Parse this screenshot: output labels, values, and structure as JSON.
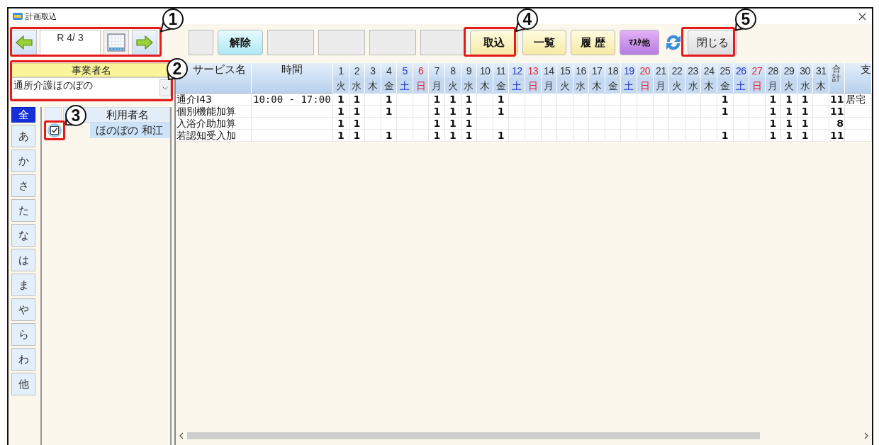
{
  "window": {
    "title": "計画取込"
  },
  "navigator": {
    "date": "R 4/ 3"
  },
  "toolbar": [
    {
      "kind": "blank"
    },
    {
      "kind": "cyan",
      "label": "解除"
    },
    {
      "kind": "blank"
    },
    {
      "kind": "blank"
    },
    {
      "kind": "blank"
    },
    {
      "kind": "blank"
    },
    {
      "kind": "yellow",
      "label": "取込"
    },
    {
      "kind": "yellow",
      "label": "一覧"
    },
    {
      "kind": "yellow",
      "label": "履 歴"
    },
    {
      "kind": "purple",
      "label": "ﾏｽﾀ他"
    },
    {
      "kind": "refresh"
    },
    {
      "kind": "gray",
      "label": "閉じる"
    }
  ],
  "provider": {
    "header": "事業者名",
    "value": "通所介護ほのぼの"
  },
  "kana_filters": [
    {
      "label": "全",
      "selected": true
    },
    {
      "label": "あ",
      "selected": false
    },
    {
      "label": "か",
      "selected": false
    },
    {
      "label": "さ",
      "selected": false
    },
    {
      "label": "た",
      "selected": false
    },
    {
      "label": "な",
      "selected": false
    },
    {
      "label": "は",
      "selected": false
    },
    {
      "label": "ま",
      "selected": false
    },
    {
      "label": "や",
      "selected": false
    },
    {
      "label": "ら",
      "selected": false
    },
    {
      "label": "わ",
      "selected": false
    },
    {
      "label": "他",
      "selected": false
    }
  ],
  "user_list": {
    "header": "利用者名",
    "rows": [
      {
        "name": "ほのぼの 和江",
        "checked": true,
        "selected": true
      }
    ]
  },
  "grid": {
    "columns": {
      "service": "サービス名",
      "time": "時間",
      "total": "合計",
      "support": "支"
    },
    "days": [
      {
        "day": "1",
        "weekday": "火",
        "kind": "weekday"
      },
      {
        "day": "2",
        "weekday": "水",
        "kind": "weekday"
      },
      {
        "day": "3",
        "weekday": "木",
        "kind": "weekday"
      },
      {
        "day": "4",
        "weekday": "金",
        "kind": "weekday"
      },
      {
        "day": "5",
        "weekday": "土",
        "kind": "saturday"
      },
      {
        "day": "6",
        "weekday": "日",
        "kind": "sunday"
      },
      {
        "day": "7",
        "weekday": "月",
        "kind": "weekday"
      },
      {
        "day": "8",
        "weekday": "火",
        "kind": "weekday"
      },
      {
        "day": "9",
        "weekday": "水",
        "kind": "weekday"
      },
      {
        "day": "10",
        "weekday": "木",
        "kind": "weekday"
      },
      {
        "day": "11",
        "weekday": "金",
        "kind": "weekday"
      },
      {
        "day": "12",
        "weekday": "土",
        "kind": "saturday"
      },
      {
        "day": "13",
        "weekday": "日",
        "kind": "sunday"
      },
      {
        "day": "14",
        "weekday": "月",
        "kind": "weekday"
      },
      {
        "day": "15",
        "weekday": "火",
        "kind": "weekday"
      },
      {
        "day": "16",
        "weekday": "水",
        "kind": "weekday"
      },
      {
        "day": "17",
        "weekday": "木",
        "kind": "weekday"
      },
      {
        "day": "18",
        "weekday": "金",
        "kind": "weekday"
      },
      {
        "day": "19",
        "weekday": "土",
        "kind": "saturday"
      },
      {
        "day": "20",
        "weekday": "日",
        "kind": "sunday"
      },
      {
        "day": "21",
        "weekday": "月",
        "kind": "weekday"
      },
      {
        "day": "22",
        "weekday": "火",
        "kind": "weekday"
      },
      {
        "day": "23",
        "weekday": "水",
        "kind": "weekday"
      },
      {
        "day": "24",
        "weekday": "木",
        "kind": "weekday"
      },
      {
        "day": "25",
        "weekday": "金",
        "kind": "weekday"
      },
      {
        "day": "26",
        "weekday": "土",
        "kind": "saturday"
      },
      {
        "day": "27",
        "weekday": "日",
        "kind": "sunday"
      },
      {
        "day": "28",
        "weekday": "月",
        "kind": "weekday"
      },
      {
        "day": "29",
        "weekday": "火",
        "kind": "weekday"
      },
      {
        "day": "30",
        "weekday": "水",
        "kind": "weekday"
      },
      {
        "day": "31",
        "weekday": "木",
        "kind": "weekday"
      }
    ],
    "rows": [
      {
        "service": "通介Ⅰ43",
        "time": "10:00 - 17:00",
        "cells": [
          "1",
          "1",
          null,
          "1",
          null,
          null,
          "1",
          "1",
          "1",
          null,
          "1",
          null,
          null,
          null,
          null,
          null,
          null,
          null,
          null,
          null,
          null,
          null,
          null,
          null,
          "1",
          null,
          null,
          "1",
          "1",
          "1",
          null
        ],
        "total": "11",
        "support": "居宅"
      },
      {
        "service": "個別機能加算",
        "cells": [
          "1",
          "1",
          null,
          "1",
          null,
          null,
          "1",
          "1",
          "1",
          null,
          "1",
          null,
          null,
          null,
          null,
          null,
          null,
          null,
          null,
          null,
          null,
          null,
          null,
          null,
          "1",
          null,
          null,
          "1",
          "1",
          "1",
          null
        ],
        "total": "11"
      },
      {
        "service": "入浴介助加算",
        "cells": [
          "1",
          "1",
          null,
          null,
          null,
          null,
          "1",
          "1",
          "1",
          null,
          null,
          null,
          null,
          null,
          null,
          null,
          null,
          null,
          null,
          null,
          null,
          null,
          null,
          null,
          null,
          null,
          null,
          "1",
          "1",
          "1",
          null
        ],
        "total": "8"
      },
      {
        "service": "若認知受入加",
        "cells": [
          "1",
          "1",
          null,
          "1",
          null,
          null,
          "1",
          "1",
          "1",
          null,
          "1",
          null,
          null,
          null,
          null,
          null,
          null,
          null,
          null,
          null,
          null,
          null,
          null,
          null,
          "1",
          null,
          null,
          "1",
          "1",
          "1",
          null
        ],
        "total": "11"
      }
    ]
  },
  "callouts": [
    {
      "label": "1"
    },
    {
      "label": "2"
    },
    {
      "label": "3"
    },
    {
      "label": "4"
    },
    {
      "label": "5"
    }
  ]
}
